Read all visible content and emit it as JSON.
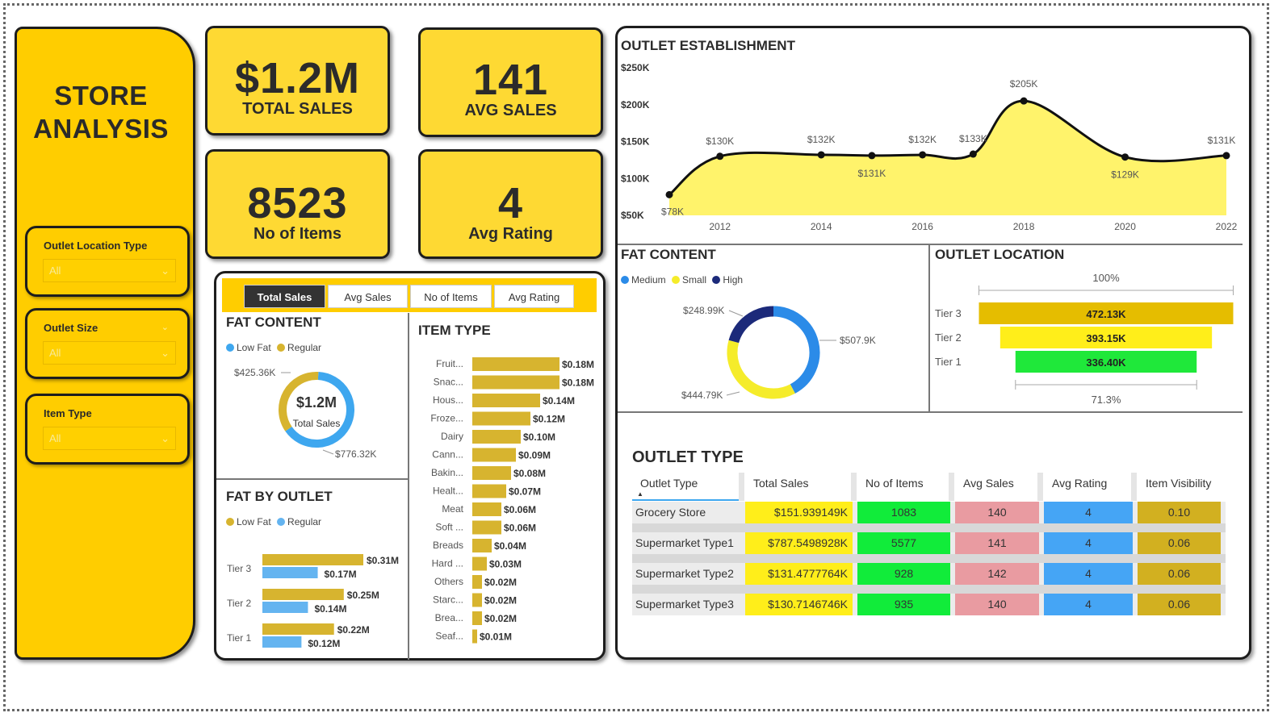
{
  "sidebar": {
    "title_line1": "STORE",
    "title_line2": "ANALYSIS",
    "filters": [
      {
        "label": "Outlet Location Type",
        "value": "All"
      },
      {
        "label": "Outlet Size",
        "value": "All"
      },
      {
        "label": "Item Type",
        "value": "All"
      }
    ]
  },
  "kpis": {
    "total_sales": {
      "value": "$1.2M",
      "label": "TOTAL SALES"
    },
    "avg_sales": {
      "value": "141",
      "label": "AVG SALES"
    },
    "no_of_items": {
      "value": "8523",
      "label": "No of Items"
    },
    "avg_rating": {
      "value": "4",
      "label": "Avg Rating"
    }
  },
  "tabs": [
    "Total Sales",
    "Avg Sales",
    "No of Items",
    "Avg Rating"
  ],
  "fat_content_small": {
    "title": "FAT CONTENT",
    "legend": [
      {
        "name": "Low Fat",
        "color": "#3ea7ef"
      },
      {
        "name": "Regular",
        "color": "#d7b42f"
      }
    ],
    "center_value": "$1.2M",
    "center_label": "Total Sales",
    "labels": [
      "$425.36K",
      "$776.32K"
    ]
  },
  "fat_by_outlet": {
    "title": "FAT BY OUTLET",
    "legend": [
      {
        "name": "Low Fat",
        "color": "#d7b42f"
      },
      {
        "name": "Regular",
        "color": "#64b4f0"
      }
    ]
  },
  "item_type": {
    "title": "ITEM TYPE"
  },
  "outlet_establishment": {
    "title": "OUTLET ESTABLISHMENT"
  },
  "fat_content_right": {
    "title": "FAT CONTENT",
    "legend": [
      {
        "name": "Medium",
        "color": "#2b8be8"
      },
      {
        "name": "Small",
        "color": "#f5ec2a"
      },
      {
        "name": "High",
        "color": "#1c2a7a"
      }
    ]
  },
  "outlet_location": {
    "title": "OUTLET LOCATION"
  },
  "outlet_type": {
    "title": "OUTLET TYPE",
    "columns": [
      "Outlet Type",
      "Total Sales",
      "No of Items",
      "Avg Sales",
      "Avg Rating",
      "Item Visibility"
    ],
    "rows": [
      [
        "Grocery Store",
        "$151.939149K",
        "1083",
        "140",
        "4",
        "0.10"
      ],
      [
        "Supermarket Type1",
        "$787.5498928K",
        "5577",
        "141",
        "4",
        "0.06"
      ],
      [
        "Supermarket Type2",
        "$131.4777764K",
        "928",
        "142",
        "4",
        "0.06"
      ],
      [
        "Supermarket Type3",
        "$130.7146746K",
        "935",
        "140",
        "4",
        "0.06"
      ]
    ]
  },
  "colors": {
    "yellow": "#ffcd00",
    "gold": "#d7b42f",
    "blue": "#3ea7ef",
    "green": "#11ec3a",
    "pink": "#e99ba1",
    "tblue": "#45a5f5",
    "tgold": "#d2b020"
  },
  "chart_data": [
    {
      "type": "line",
      "title": "OUTLET ESTABLISHMENT",
      "x": [
        2011,
        2012,
        2014,
        2015,
        2016,
        2017,
        2018,
        2020,
        2022
      ],
      "y": [
        78,
        130,
        132,
        131,
        132,
        133,
        205,
        129,
        131
      ],
      "point_labels": [
        "$78K",
        "$130K",
        "$132K",
        "$131K",
        "$132K",
        "$133K",
        "$205K",
        "$129K",
        "$131K"
      ],
      "x_ticks": [
        "2012",
        "2014",
        "2016",
        "2018",
        "2020",
        "2022"
      ],
      "y_ticks": [
        "$50K",
        "$100K",
        "$150K",
        "$200K",
        "$250K"
      ],
      "ylim": [
        50,
        250
      ],
      "xlim": [
        2011,
        2022
      ]
    },
    {
      "type": "pie",
      "title": "FAT CONTENT",
      "labels": [
        "Low Fat",
        "Regular"
      ],
      "values": [
        776.32,
        425.36
      ],
      "value_labels": [
        "$776.32K",
        "$425.36K"
      ]
    },
    {
      "type": "bar",
      "title": "ITEM TYPE",
      "categories": [
        "Fruit...",
        "Snac...",
        "Hous...",
        "Froze...",
        "Dairy",
        "Cann...",
        "Bakin...",
        "Healt...",
        "Meat",
        "Soft ...",
        "Breads",
        "Hard ...",
        "Others",
        "Starc...",
        "Brea...",
        "Seaf..."
      ],
      "values": [
        0.18,
        0.18,
        0.14,
        0.12,
        0.1,
        0.09,
        0.08,
        0.07,
        0.06,
        0.06,
        0.04,
        0.03,
        0.02,
        0.02,
        0.02,
        0.01
      ],
      "value_labels": [
        "$0.18M",
        "$0.18M",
        "$0.14M",
        "$0.12M",
        "$0.10M",
        "$0.09M",
        "$0.08M",
        "$0.07M",
        "$0.06M",
        "$0.06M",
        "$0.04M",
        "$0.03M",
        "$0.02M",
        "$0.02M",
        "$0.02M",
        "$0.01M"
      ]
    },
    {
      "type": "bar",
      "title": "FAT BY OUTLET",
      "categories": [
        "Tier 3",
        "Tier 2",
        "Tier 1"
      ],
      "series": [
        {
          "name": "Low Fat",
          "values": [
            0.31,
            0.25,
            0.22
          ],
          "value_labels": [
            "$0.31M",
            "$0.25M",
            "$0.22M"
          ]
        },
        {
          "name": "Regular",
          "values": [
            0.17,
            0.14,
            0.12
          ],
          "value_labels": [
            "$0.17M",
            "$0.14M",
            "$0.12M"
          ]
        }
      ]
    },
    {
      "type": "pie",
      "title": "FAT CONTENT",
      "labels": [
        "Medium",
        "Small",
        "High"
      ],
      "values": [
        507.9,
        444.79,
        248.99
      ],
      "value_labels": [
        "$507.9K",
        "$444.79K",
        "$248.99K"
      ]
    },
    {
      "type": "bar",
      "title": "OUTLET LOCATION",
      "categories": [
        "Tier 3",
        "Tier 2",
        "Tier 1"
      ],
      "values": [
        472.13,
        393.15,
        336.4
      ],
      "value_labels": [
        "472.13K",
        "393.15K",
        "336.40K"
      ],
      "top_label": "100%",
      "bottom_label": "71.3%"
    }
  ]
}
